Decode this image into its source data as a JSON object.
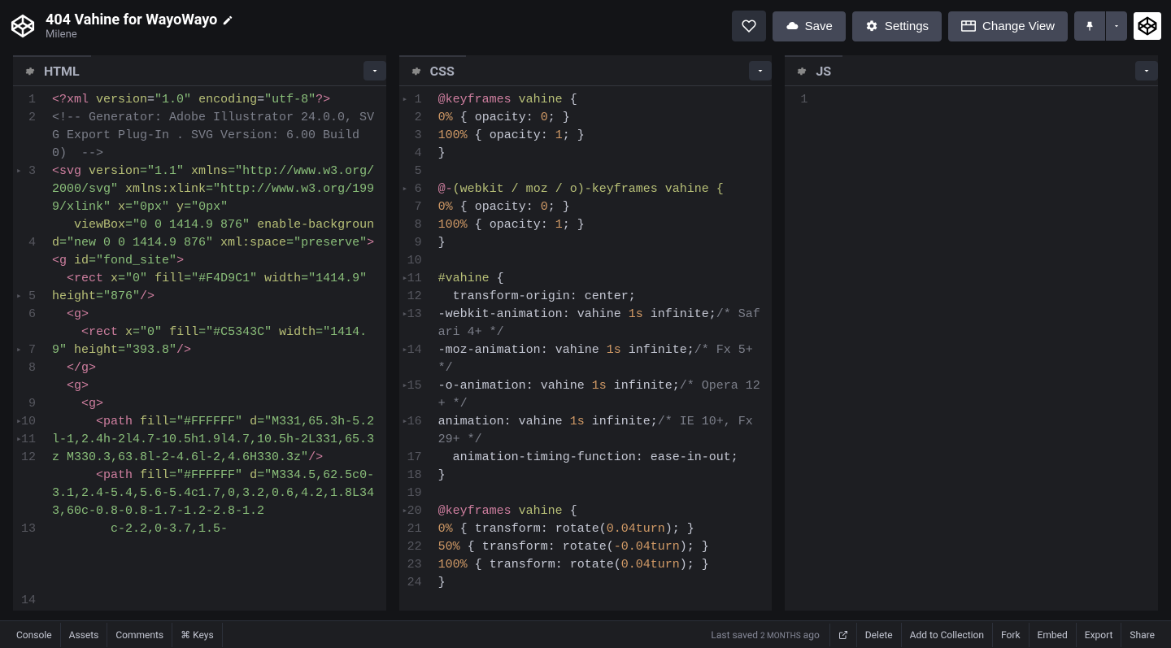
{
  "header": {
    "title": "404 Vahine for WayoWayo",
    "author": "Milene",
    "save": "Save",
    "settings": "Settings",
    "changeView": "Change View"
  },
  "editors": {
    "html": {
      "title": "HTML"
    },
    "css": {
      "title": "CSS"
    },
    "js": {
      "title": "JS"
    }
  },
  "htmlLines": [
    "1",
    "2",
    "3",
    "4",
    "5",
    "6",
    "7",
    "8",
    "9",
    "10",
    "11",
    "12",
    "13",
    "14"
  ],
  "cssLines": [
    "1",
    "2",
    "3",
    "4",
    "5",
    "6",
    "7",
    "8",
    "9",
    "10",
    "11",
    "12",
    "13",
    "14",
    "15",
    "16",
    "17",
    "18",
    "19",
    "20",
    "21",
    "22",
    "23",
    "24"
  ],
  "jsLines": [
    "1"
  ],
  "htmlCode": {
    "l1a": "<?xml",
    "l1b": " version",
    "l1c": "=",
    "l1d": "\"1.0\"",
    "l1e": " encoding",
    "l1f": "=",
    "l1g": "\"utf-8\"",
    "l1h": "?>",
    "l2": "<!-- Generator: Adobe Illustrator 24.0.0, SVG Export Plug-In . SVG Version: 6.00 Build 0)  -->",
    "l3a": "<svg",
    "l3b": " version",
    "l3c": "=\"1.1\"",
    "l3d": " xmlns",
    "l3e": "=\"http://www.w3.org/2000/svg\"",
    "l3f": " xmlns:xlink",
    "l3g": "=\"http://www.w3.org/1999/xlink\"",
    "l3h": " x",
    "l3i": "=\"0px\"",
    "l3j": " y",
    "l3k": "=\"0px\"",
    "l4a": "   viewBox",
    "l4b": "=\"0 0 1414.9 876\"",
    "l4c": " enable-background",
    "l4d": "=\"new 0 0 1414.9 876\"",
    "l4e": " xml:space",
    "l4f": "=\"preserve\"",
    "l4g": ">",
    "l5a": "<g",
    "l5b": " id",
    "l5c": "=\"fond_site\"",
    "l5d": ">",
    "l6a": "  <rect",
    "l6b": " x",
    "l6c": "=\"0\"",
    "l6d": " fill",
    "l6e": "=\"#F4D9C1\"",
    "l6f": " width",
    "l6g": "=\"1414.9\"",
    "l6h": " height",
    "l6i": "=\"876\"",
    "l6j": "/>",
    "l7a": "  <g>",
    "l8a": "    <rect",
    "l8b": " x",
    "l8c": "=\"0\"",
    "l8d": " fill",
    "l8e": "=\"#C5343C\"",
    "l8f": " width",
    "l8g": "=\"1414.9\"",
    "l8h": " height",
    "l8i": "=\"393.8\"",
    "l8j": "/>",
    "l9": "  </g>",
    "l10": "  <g>",
    "l11": "    <g>",
    "l12a": "      <path",
    "l12b": " fill",
    "l12c": "=\"#FFFFFF\"",
    "l12d": " d",
    "l12e": "=\"M331,65.3h-5.2l-1,2.4h-2l4.7-10.5h1.9l4.7,10.5h-2L331,65.3z M330.3,63.8l-2-4.6l-2,4.6H330.3z\"",
    "l12f": "/>",
    "l13a": "      <path",
    "l13b": " fill",
    "l13c": "=\"#FFFFFF\"",
    "l13d": " d",
    "l13e": "=\"M334.5,62.5c0-3.1,2.4-5.4,5.6-5.4c1.7,0,3.2,0.6,4.2,1.8L343,60c-0.8-0.8-1.7-1.2-2.8-1.2",
    "l14a": "        c-2.2,0-3.7,1.5-"
  },
  "cssCode": {
    "l1a": "@keyframes",
    "l1b": " vahine ",
    "l1c": "{",
    "l2a": "0%",
    "l2b": " { ",
    "l2c": "opacity",
    "l2d": ": ",
    "l2e": "0",
    "l2f": "; }",
    "l3a": "100%",
    "l3b": " { ",
    "l3c": "opacity",
    "l3d": ": ",
    "l3e": "1",
    "l3f": "; }",
    "l4": "}",
    "l5": "",
    "l6a": "@-",
    "l6b": "(webkit / moz / o)",
    "l6c": "-keyframes vahine {",
    "l7a": "0%",
    "l7b": " { ",
    "l7c": "opacity",
    "l7d": ": ",
    "l7e": "0",
    "l7f": "; }",
    "l8a": "100%",
    "l8b": " { ",
    "l8c": "opacity",
    "l8d": ": ",
    "l8e": "1",
    "l8f": "; }",
    "l9": "}",
    "l10": "",
    "l11a": "#vahine",
    "l11b": " {",
    "l12a": "  transform-origin",
    "l12b": ": center;",
    "l13a": "-webkit-animation",
    "l13b": ": vahine ",
    "l13c": "1s",
    "l13d": " infinite;",
    "l13e": "/* Safari 4+ */",
    "l14a": "-moz-animation",
    "l14b": ": vahine ",
    "l14c": "1s",
    "l14d": " infinite;",
    "l14e": "/* Fx 5+ */",
    "l15a": "-o-animation",
    "l15b": ": vahine ",
    "l15c": "1s",
    "l15d": " infinite;",
    "l15e": "/* Opera 12+ */",
    "l16a": "animation",
    "l16b": ": vahine ",
    "l16c": "1s",
    "l16d": " infinite;",
    "l16e": "/* IE 10+, Fx 29+ */",
    "l17a": "  animation-timing-function",
    "l17b": ": ease-in-out;",
    "l18": "}",
    "l19": "",
    "l20a": "@keyframes",
    "l20b": " vahine ",
    "l20c": "{",
    "l21a": "0%",
    "l21b": " { ",
    "l21c": "transform",
    "l21d": ": rotate(",
    "l21e": "0.04turn",
    "l21f": "); }",
    "l22a": "50%",
    "l22b": " { ",
    "l22c": "transform",
    "l22d": ": rotate(",
    "l22e": "-0.04turn",
    "l22f": "); }",
    "l23a": "100%",
    "l23b": " { ",
    "l23c": "transform",
    "l23d": ": rotate(",
    "l23e": "0.04turn",
    "l23f": "); }",
    "l24": "}"
  },
  "footer": {
    "console": "Console",
    "assets": "Assets",
    "comments": "Comments",
    "keys": "⌘ Keys",
    "lastSavedPrefix": "Last saved ",
    "lastSavedValue": "2 MONTHS",
    "lastSavedSuffix": " ago",
    "delete": "Delete",
    "addToCollection": "Add to Collection",
    "fork": "Fork",
    "embed": "Embed",
    "export": "Export",
    "share": "Share"
  }
}
